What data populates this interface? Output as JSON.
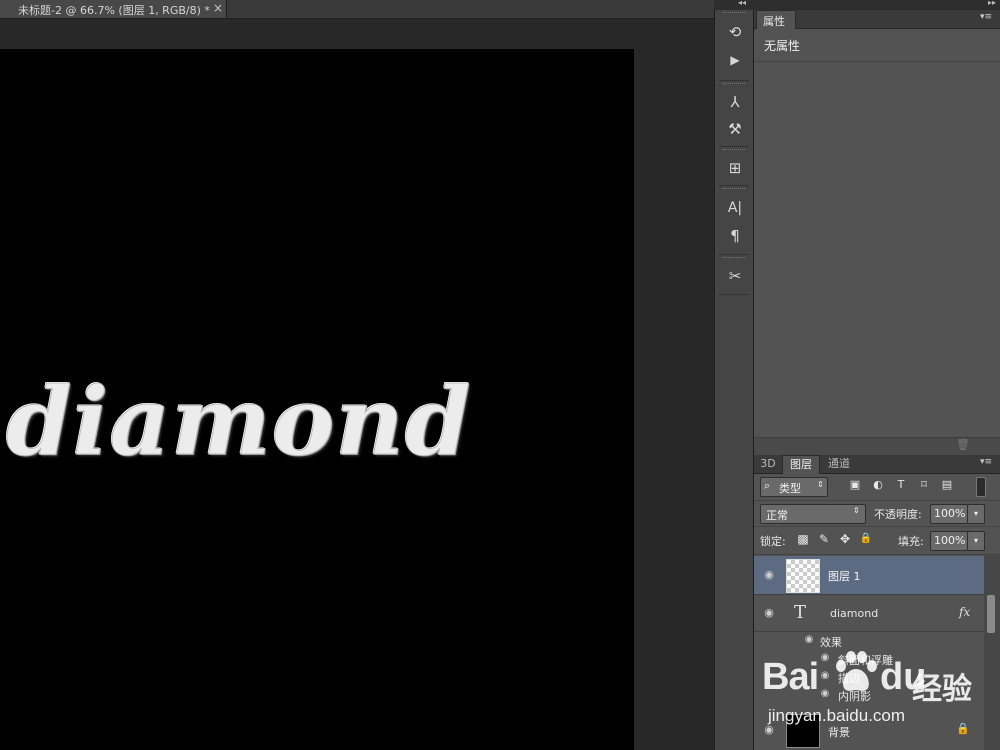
{
  "document_tab": {
    "label": "未标题-2 @ 66.7% (图层 1, RGB/8) *",
    "close": "×"
  },
  "canvas": {
    "text": "diamond",
    "background": "#000000"
  },
  "dock": {
    "collapse": "◂◂",
    "icons": [
      "history-icon",
      "play-actions-icon",
      "brush-presets-icon",
      "brush-settings-icon",
      "clone-source-icon",
      "character-icon",
      "paragraph-icon",
      "tool-presets-icon"
    ],
    "glyphs": {
      "history": "⟲",
      "actions": "▶",
      "brush_presets": "⅄",
      "brush": "⚒",
      "clone": "⊞",
      "character": "A|",
      "paragraph": "¶",
      "tool_presets": "✂"
    }
  },
  "right_collapse": "▸▸",
  "properties": {
    "tab": "属性",
    "menu": "▾≡",
    "empty_text": "无属性",
    "trash": "🗑"
  },
  "layers_panel": {
    "tabs": [
      "3D",
      "图层",
      "通道"
    ],
    "menu": "▾≡",
    "filter": {
      "icon": "⌕",
      "kind": "类型",
      "arrow": "⇕",
      "icons": [
        "▣",
        "◐",
        "T",
        "⌑",
        "▤"
      ]
    },
    "blend_mode": "正常",
    "blend_arrow": "⇕",
    "opacity_label": "不透明度:",
    "opacity_value": "100%",
    "dropdown_glyph": "▾",
    "lock_label": "锁定:",
    "lock_icons": [
      "▩",
      "✎",
      "✥",
      "🔒"
    ],
    "fill_label": "填充:",
    "fill_value": "100%",
    "eye_glyph": "◉",
    "layers": [
      {
        "name": "图层 1",
        "selected": true
      },
      {
        "name": "diamond",
        "type_glyph": "T",
        "fx": "fx"
      },
      {
        "name": "背景",
        "lock": "🔒"
      }
    ],
    "effects": {
      "header": "效果",
      "items": [
        "斜面和浮雕",
        "描边",
        "内阴影"
      ]
    }
  },
  "watermark": {
    "brand_left": "Bai",
    "brand_right": "du",
    "brand_cn": "经验",
    "url": "jingyan.baidu.com"
  },
  "colors": {
    "selected_layer": "#5d6b82",
    "panel_bg": "#535353",
    "workspace_bg": "#282828"
  }
}
